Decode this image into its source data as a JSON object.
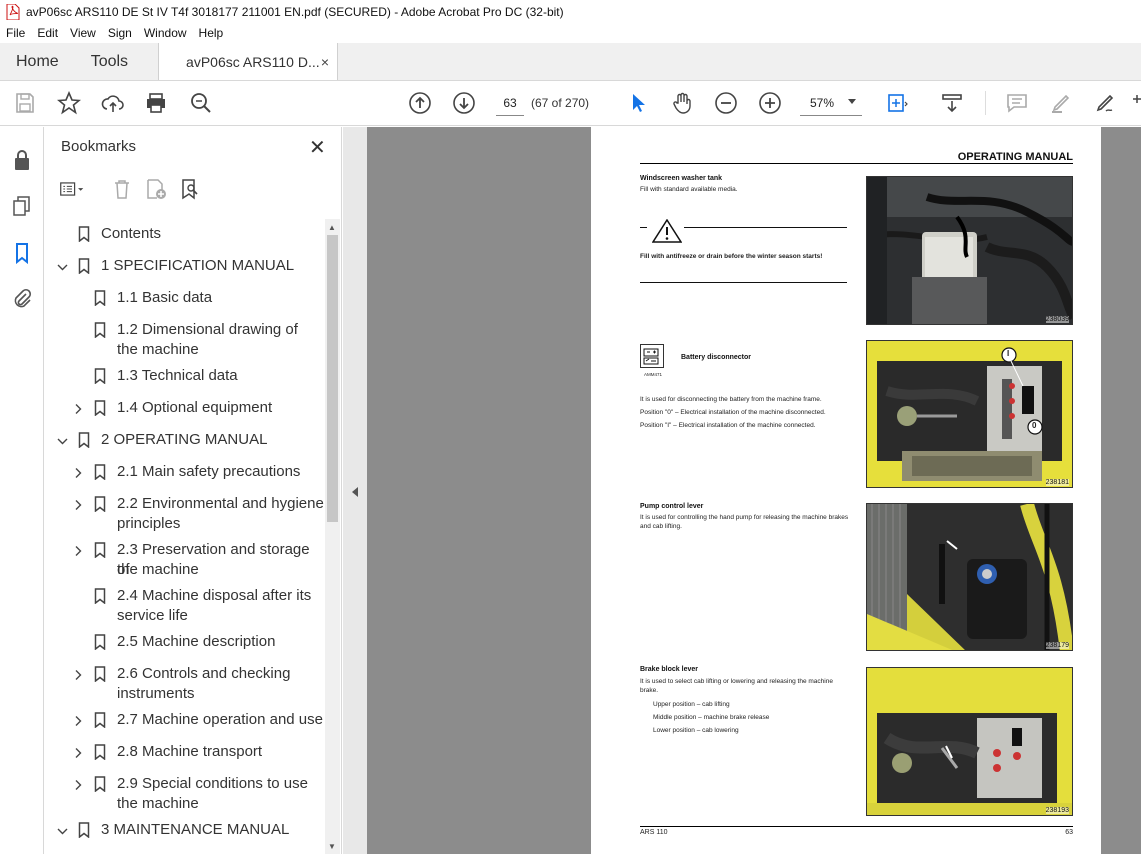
{
  "window": {
    "title": "avP06sc ARS110 DE St IV T4f 3018177 211001 EN.pdf (SECURED) - Adobe Acrobat Pro DC (32-bit)"
  },
  "menu": [
    "File",
    "Edit",
    "View",
    "Sign",
    "Window",
    "Help"
  ],
  "tabs": {
    "home": "Home",
    "tools": "Tools",
    "document": "avP06sc ARS110 D...",
    "close": "×"
  },
  "toolbar": {
    "page_number": "63",
    "page_count": "(67 of 270)",
    "zoom": "57%"
  },
  "bookmarks": {
    "title": "Bookmarks",
    "close": "✕",
    "items": [
      {
        "label": "Contents",
        "level": 0,
        "expand": "none"
      },
      {
        "label": "1 SPECIFICATION MANUAL",
        "level": 0,
        "expand": "open"
      },
      {
        "label": "1.1 Basic data",
        "level": 1,
        "expand": "none"
      },
      {
        "label": "1.2 Dimensional drawing of",
        "label2": "the machine",
        "level": 1,
        "expand": "none"
      },
      {
        "label": "1.3 Technical data",
        "level": 1,
        "expand": "none"
      },
      {
        "label": "1.4 Optional equipment",
        "level": 1,
        "expand": "closed"
      },
      {
        "label": "2 OPERATING MANUAL",
        "level": 0,
        "expand": "open"
      },
      {
        "label": "2.1 Main safety precautions",
        "level": 1,
        "expand": "closed"
      },
      {
        "label": "2.2 Environmental and hygiene",
        "label2": "principles",
        "level": 1,
        "expand": "closed"
      },
      {
        "label": "2.3 Preservation and storage of",
        "label2": "the machine",
        "level": 1,
        "expand": "closed"
      },
      {
        "label": "2.4 Machine disposal after its",
        "label2": "service life",
        "level": 1,
        "expand": "none"
      },
      {
        "label": "2.5 Machine description",
        "level": 1,
        "expand": "none"
      },
      {
        "label": "2.6 Controls and checking",
        "label2": "instruments",
        "level": 1,
        "expand": "closed"
      },
      {
        "label": "2.7 Machine operation and use",
        "level": 1,
        "expand": "closed"
      },
      {
        "label": "2.8 Machine transport",
        "level": 1,
        "expand": "closed"
      },
      {
        "label": "2.9 Special conditions to use",
        "label2": "the machine",
        "level": 1,
        "expand": "closed"
      },
      {
        "label": "3 MAINTENANCE MANUAL",
        "level": 0,
        "expand": "open"
      }
    ]
  },
  "page": {
    "header": "OPERATING MANUAL",
    "sections": {
      "washer_title": "Windscreen washer tank",
      "washer_text": "Fill with standard available media.",
      "washer_warning": "Fill with antifreeze or drain before the winter season starts!",
      "battery_title": "Battery disconnector",
      "battery_icon_code": "AMM471",
      "battery_text1": "It is used for disconnecting the battery from the machine frame.",
      "battery_text2": "Position \"0\" – Electrical installation of the machine disconnected.",
      "battery_text3": "Position \"I\" – Electrical installation of the machine connected.",
      "pump_title": "Pump control lever",
      "pump_text": "It is used for controlling the hand pump for releasing the machine brakes and cab lifting.",
      "brake_title": "Brake block lever",
      "brake_text": "It is used to select cab lifting or lowering and releasing the machine brake.",
      "brake_upper": "Upper position – cab lifting",
      "brake_middle": "Middle position – machine brake release",
      "brake_lower": "Lower position – cab lowering"
    },
    "photos": {
      "p1": "238039",
      "p2": "238181",
      "p3": "238179",
      "p4": "238193",
      "callout_i": "I",
      "callout_o": "0"
    },
    "footer_left": "ARS 110",
    "footer_right": "63"
  }
}
